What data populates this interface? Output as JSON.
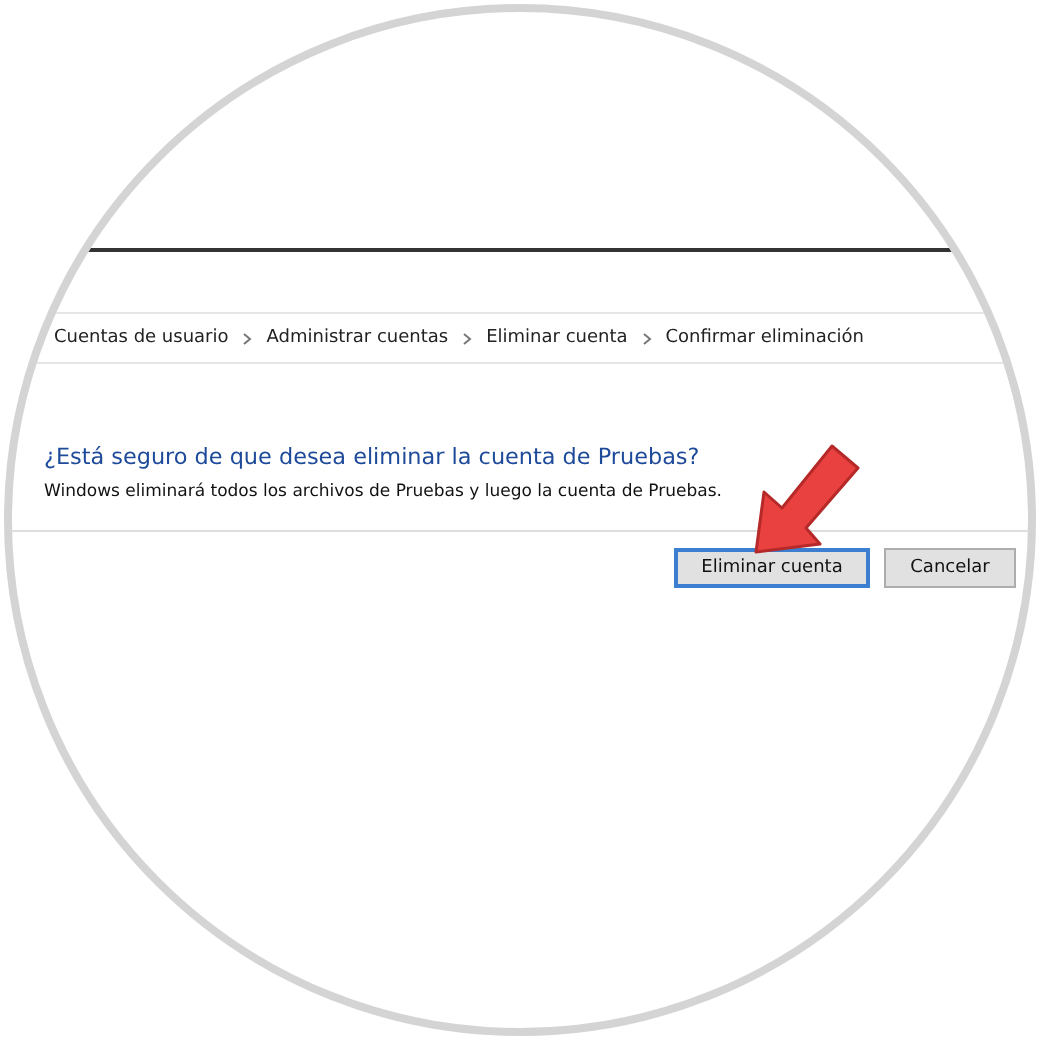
{
  "breadcrumb": [
    {
      "label": "Cuentas de usuario"
    },
    {
      "label": "Administrar cuentas"
    },
    {
      "label": "Eliminar cuenta"
    },
    {
      "label": "Confirmar eliminación"
    }
  ],
  "heading": "¿Está seguro de que desea eliminar la cuenta de Pruebas?",
  "message": "Windows eliminará todos los archivos de Pruebas y luego la cuenta de Pruebas.",
  "buttons": [
    {
      "label": "Eliminar cuenta",
      "default": true
    },
    {
      "label": "Cancelar",
      "default": false
    }
  ]
}
